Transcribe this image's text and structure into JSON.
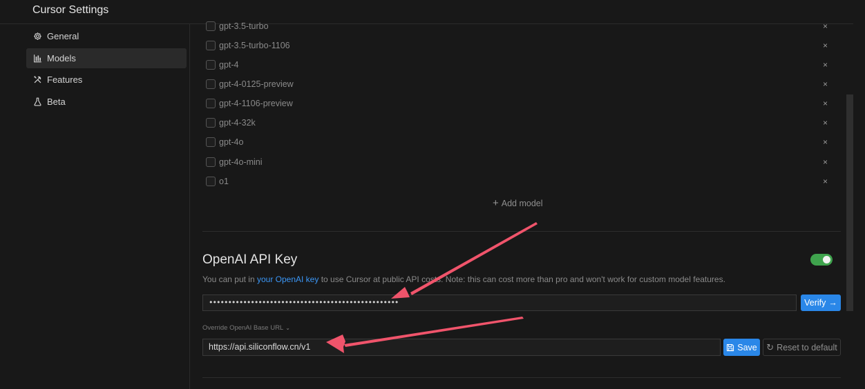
{
  "window": {
    "title": "Cursor Settings"
  },
  "sidebar": {
    "items": [
      {
        "label": "General",
        "icon": "gear-icon",
        "active": false
      },
      {
        "label": "Models",
        "icon": "bar-chart-icon",
        "active": true
      },
      {
        "label": "Features",
        "icon": "tools-icon",
        "active": false
      },
      {
        "label": "Beta",
        "icon": "flask-icon",
        "active": false
      }
    ]
  },
  "models": {
    "items": [
      {
        "name": "gpt-3.5-turbo",
        "checked": false
      },
      {
        "name": "gpt-3.5-turbo-1106",
        "checked": false
      },
      {
        "name": "gpt-4",
        "checked": false
      },
      {
        "name": "gpt-4-0125-preview",
        "checked": false
      },
      {
        "name": "gpt-4-1106-preview",
        "checked": false
      },
      {
        "name": "gpt-4-32k",
        "checked": false
      },
      {
        "name": "gpt-4o",
        "checked": false
      },
      {
        "name": "gpt-4o-mini",
        "checked": false
      },
      {
        "name": "o1",
        "checked": false
      }
    ],
    "remove_symbol": "×",
    "add_label": "Add model"
  },
  "openai": {
    "title": "OpenAI API Key",
    "enabled": true,
    "desc_prefix": "You can put in ",
    "desc_link": "your OpenAI key",
    "desc_suffix": " to use Cursor at public API costs. Note: this can cost more than pro and won't work for custom model features.",
    "api_key_value": "••••••••••••••••••••••••••••••••••••••••••••••••••",
    "verify_label": "Verify",
    "override_label": "Override OpenAI Base URL",
    "base_url_value": "https://api.siliconflow.cn/v1",
    "save_label": "Save",
    "reset_label": "Reset to default"
  },
  "colors": {
    "accent": "#2a87e8",
    "toggle_on": "#3fa34d",
    "annotation_arrow": "#f0546b"
  }
}
